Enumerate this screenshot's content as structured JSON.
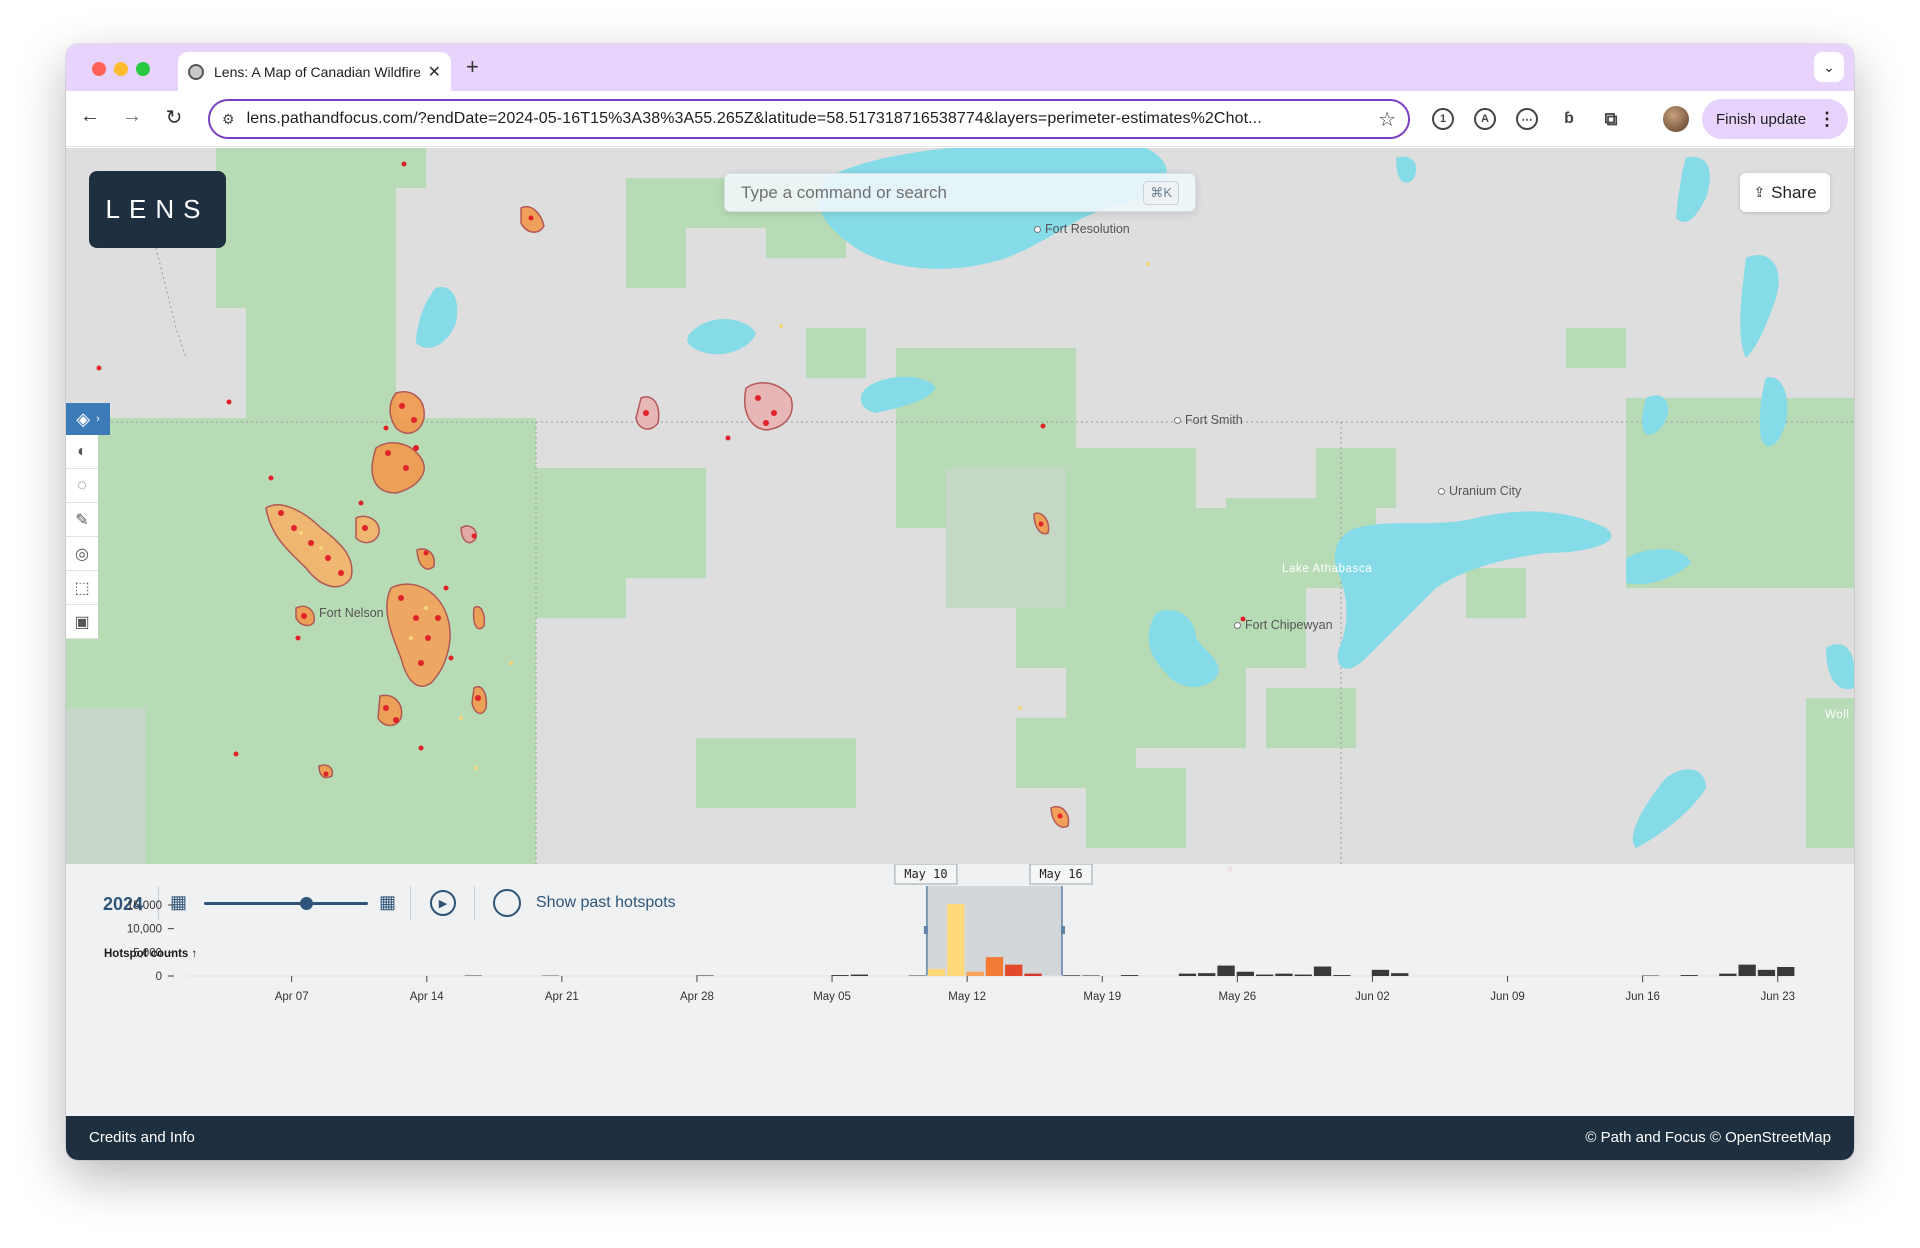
{
  "browser": {
    "tab_title": "Lens: A Map of Canadian Wildfires",
    "new_tab_icon": "+",
    "close_icon": "✕",
    "url": "lens.pathandfocus.com/?endDate=2024-05-16T15%3A38%3A55.265Z&latitude=58.517318716538774&layers=perimeter-estimates%2Chot...",
    "finish_update_label": "Finish update",
    "extension_labels": [
      "1",
      "A",
      "⋯",
      "ɓ"
    ]
  },
  "app": {
    "logo_text": "LENS",
    "search_placeholder": "Type a command or search",
    "search_shortcut": "⌘K",
    "share_label": "Share",
    "tools": [
      "layers-icon",
      "wind-icon",
      "perimeter-icon",
      "draw-icon",
      "pin-icon",
      "select-icon",
      "frame-icon"
    ]
  },
  "map": {
    "places": [
      {
        "name": "Fort Resolution"
      },
      {
        "name": "Fort Smith"
      },
      {
        "name": "Uranium City"
      },
      {
        "name": "Fort Nelson"
      },
      {
        "name": "Fort Chipewyan"
      }
    ],
    "lake_label": "Lake Athabasca",
    "edge_label": "Woll"
  },
  "timeline": {
    "year": "2024",
    "slider_position": 0.62,
    "show_past_label": "Show past hotspots",
    "hotspot_title": "Hotspot counts ↑",
    "range_start_label": "May 10",
    "range_end_label": "May 16"
  },
  "chart_data": {
    "type": "bar",
    "title": "Hotspot counts ↑",
    "ylabel": "",
    "yticks": [
      "15,000",
      "10,000",
      "5,000",
      "0"
    ],
    "ylim": [
      0,
      15000
    ],
    "xticks": [
      "Apr 07",
      "Apr 14",
      "Apr 21",
      "Apr 28",
      "May 05",
      "May 12",
      "May 19",
      "May 26",
      "Jun 02",
      "Jun 09",
      "Jun 16",
      "Jun 23"
    ],
    "x_start": "2024-04-07",
    "selected_range": [
      "2024-05-10",
      "2024-05-16"
    ],
    "series": [
      {
        "values": [
          {
            "date": "2024-04-16",
            "value": 100
          },
          {
            "date": "2024-04-20",
            "value": 80
          },
          {
            "date": "2024-04-28",
            "value": 120
          },
          {
            "date": "2024-05-05",
            "value": 200
          },
          {
            "date": "2024-05-06",
            "value": 300
          },
          {
            "date": "2024-05-09",
            "value": 100
          },
          {
            "date": "2024-05-10",
            "value": 1500,
            "color": "#ffd97a"
          },
          {
            "date": "2024-05-11",
            "value": 15200,
            "color": "#ffd97a"
          },
          {
            "date": "2024-05-12",
            "value": 900,
            "color": "#f9a45a"
          },
          {
            "date": "2024-05-13",
            "value": 4000,
            "color": "#f37b35"
          },
          {
            "date": "2024-05-14",
            "value": 2400,
            "color": "#e24a2c"
          },
          {
            "date": "2024-05-15",
            "value": 500,
            "color": "#d5382a"
          },
          {
            "date": "2024-05-17",
            "value": 150
          },
          {
            "date": "2024-05-18",
            "value": 120
          },
          {
            "date": "2024-05-20",
            "value": 200
          },
          {
            "date": "2024-05-23",
            "value": 500
          },
          {
            "date": "2024-05-24",
            "value": 600
          },
          {
            "date": "2024-05-25",
            "value": 2200
          },
          {
            "date": "2024-05-26",
            "value": 900
          },
          {
            "date": "2024-05-27",
            "value": 300
          },
          {
            "date": "2024-05-28",
            "value": 500
          },
          {
            "date": "2024-05-29",
            "value": 300
          },
          {
            "date": "2024-05-30",
            "value": 2000
          },
          {
            "date": "2024-05-31",
            "value": 200
          },
          {
            "date": "2024-06-02",
            "value": 1300
          },
          {
            "date": "2024-06-03",
            "value": 600
          },
          {
            "date": "2024-06-16",
            "value": 100
          },
          {
            "date": "2024-06-18",
            "value": 200
          },
          {
            "date": "2024-06-20",
            "value": 500
          },
          {
            "date": "2024-06-21",
            "value": 2400
          },
          {
            "date": "2024-06-22",
            "value": 1300
          },
          {
            "date": "2024-06-23",
            "value": 1900
          }
        ]
      }
    ],
    "default_bar_color": "#3a3a3a"
  },
  "footer": {
    "credits": "Credits and Info",
    "copyright": "© Path and Focus © OpenStreetMap"
  },
  "colors": {
    "water": "#86dbe8",
    "forest": "#b5dbb3",
    "land": "#dedede",
    "fire_red": "#e0232a",
    "fire_orange": "#f08a3c",
    "fire_yellow": "#f6d57a",
    "navy": "#1e2f3f"
  }
}
